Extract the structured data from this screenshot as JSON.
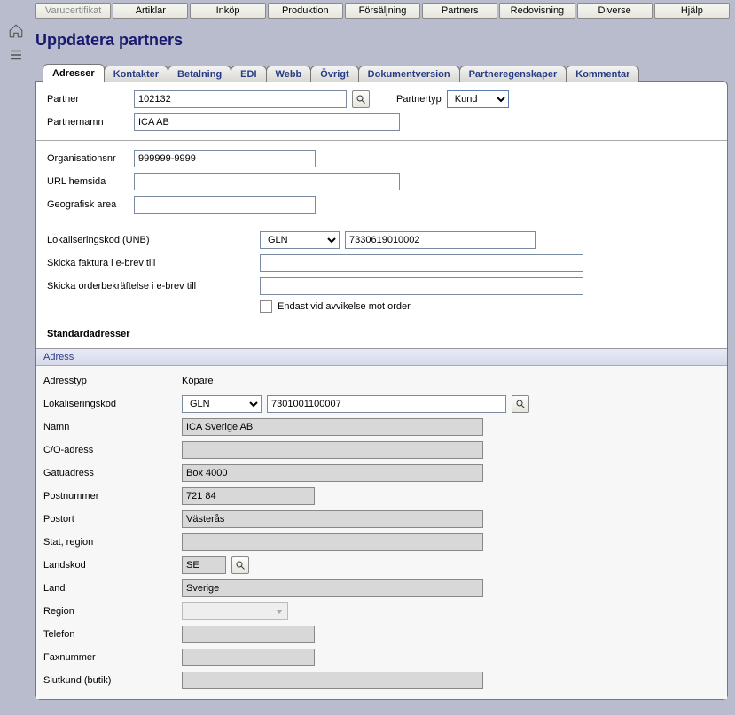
{
  "menu": {
    "items": [
      "Varucertifikat",
      "Artiklar",
      "Inköp",
      "Produktion",
      "Försäljning",
      "Partners",
      "Redovisning",
      "Diverse",
      "Hjälp"
    ],
    "disabled_index": 0
  },
  "title": "Uppdatera partners",
  "tabs": [
    "Adresser",
    "Kontakter",
    "Betalning",
    "EDI",
    "Webb",
    "Övrigt",
    "Dokumentversion",
    "Partneregenskaper",
    "Kommentar"
  ],
  "active_tab": 0,
  "partner": {
    "label": "Partner",
    "value": "102132",
    "type_label": "Partnertyp",
    "type_value": "Kund",
    "name_label": "Partnernamn",
    "name_value": "ICA AB"
  },
  "org": {
    "orgnr_label": "Organisationsnr",
    "orgnr_value": "999999-9999",
    "url_label": "URL hemsida",
    "url_value": "",
    "geo_label": "Geografisk area",
    "geo_value": ""
  },
  "loc": {
    "label": "Lokaliseringskod (UNB)",
    "sel": "GLN",
    "code": "7330619010002",
    "inv_label": "Skicka faktura i e-brev till",
    "inv_value": "",
    "ack_label": "Skicka orderbekräftelse i e-brev till",
    "ack_value": "",
    "chk_label": "Endast vid avvikelse mot order"
  },
  "std_head": "Standardadresser",
  "addr_title": "Adress",
  "addr": {
    "type_label": "Adresstyp",
    "type_value": "Köpare",
    "lok_label": "Lokaliseringskod",
    "lok_sel": "GLN",
    "lok_code": "7301001100007",
    "namn_label": "Namn",
    "namn": "ICA Sverige AB",
    "co_label": "C/O-adress",
    "co": "",
    "gata_label": "Gatuadress",
    "gata": "Box 4000",
    "postnr_label": "Postnummer",
    "postnr": "721 84",
    "postort_label": "Postort",
    "postort": "Västerås",
    "stat_label": "Stat, region",
    "stat": "",
    "landkod_label": "Landskod",
    "landkod": "SE",
    "land_label": "Land",
    "land": "Sverige",
    "region_label": "Region",
    "tel_label": "Telefon",
    "tel": "",
    "fax_label": "Faxnummer",
    "fax": "",
    "slut_label": "Slutkund (butik)",
    "slut": ""
  }
}
